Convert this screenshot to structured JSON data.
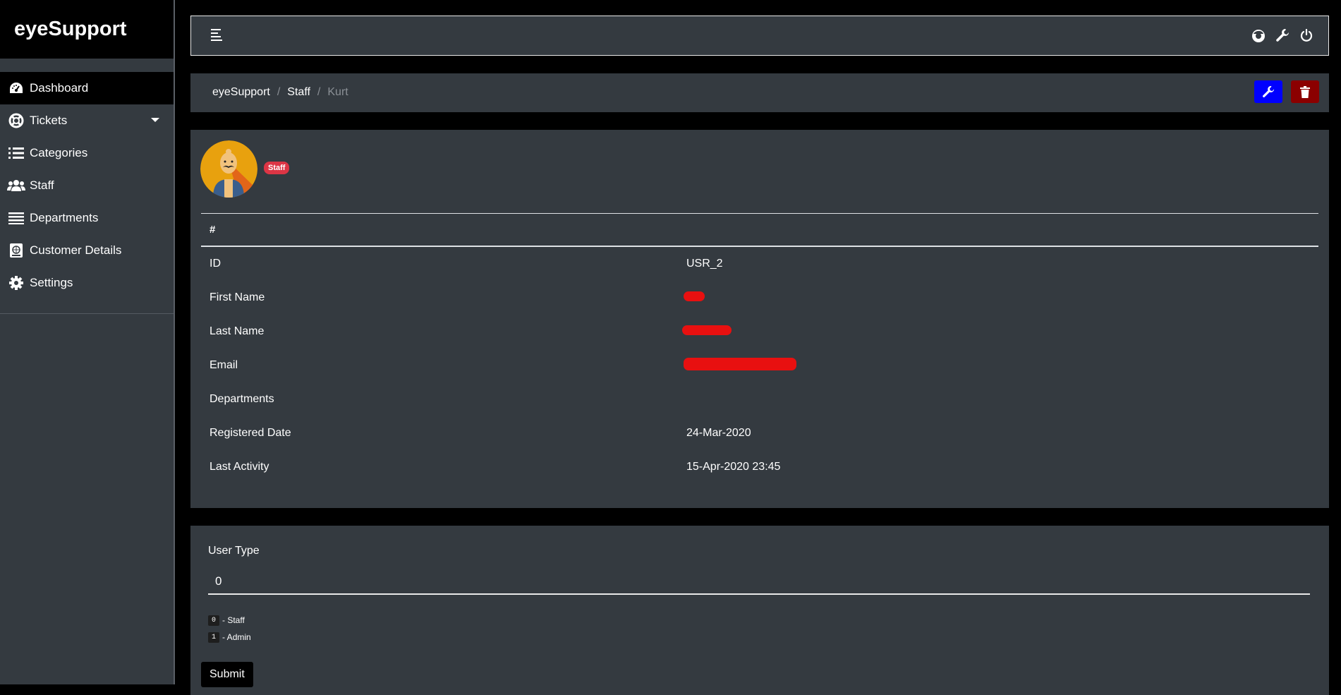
{
  "app": {
    "brand": "eyeSupport"
  },
  "sidebar": {
    "items": [
      {
        "label": "Dashboard",
        "icon": "tachometer-icon"
      },
      {
        "label": "Tickets",
        "icon": "life-ring-icon"
      },
      {
        "label": "Categories",
        "icon": "list-icon"
      },
      {
        "label": "Staff",
        "icon": "users-icon"
      },
      {
        "label": "Departments",
        "icon": "bars-icon"
      },
      {
        "label": "Customer Details",
        "icon": "address-book-icon"
      },
      {
        "label": "Settings",
        "icon": "gear-icon"
      }
    ]
  },
  "topbar": {
    "icons": [
      "hamburger-icon",
      "user-avatar-icon",
      "wrench-icon",
      "power-icon"
    ]
  },
  "breadcrumb": {
    "root": "eyeSupport",
    "section": "Staff",
    "current": "Kurt"
  },
  "profile": {
    "badge": "Staff",
    "table_header": "#",
    "rows": [
      {
        "label": "ID",
        "value": "USR_2"
      },
      {
        "label": "First Name",
        "value": ""
      },
      {
        "label": "Last Name",
        "value": ""
      },
      {
        "label": "Email",
        "value": ""
      },
      {
        "label": "Departments",
        "value": ""
      },
      {
        "label": "Registered Date",
        "value": "24-Mar-2020"
      },
      {
        "label": "Last Activity",
        "value": "15-Apr-2020 23:45"
      }
    ]
  },
  "user_type": {
    "label": "User Type",
    "value": "0",
    "legend": [
      {
        "code": "0",
        "text": "- Staff"
      },
      {
        "code": "1",
        "text": "- Admin"
      }
    ],
    "submit": "Submit"
  },
  "colors": {
    "edit_button": "#0000ff",
    "delete_button": "#8b0000",
    "badge": "#dc3545",
    "redaction": "#e81010"
  }
}
